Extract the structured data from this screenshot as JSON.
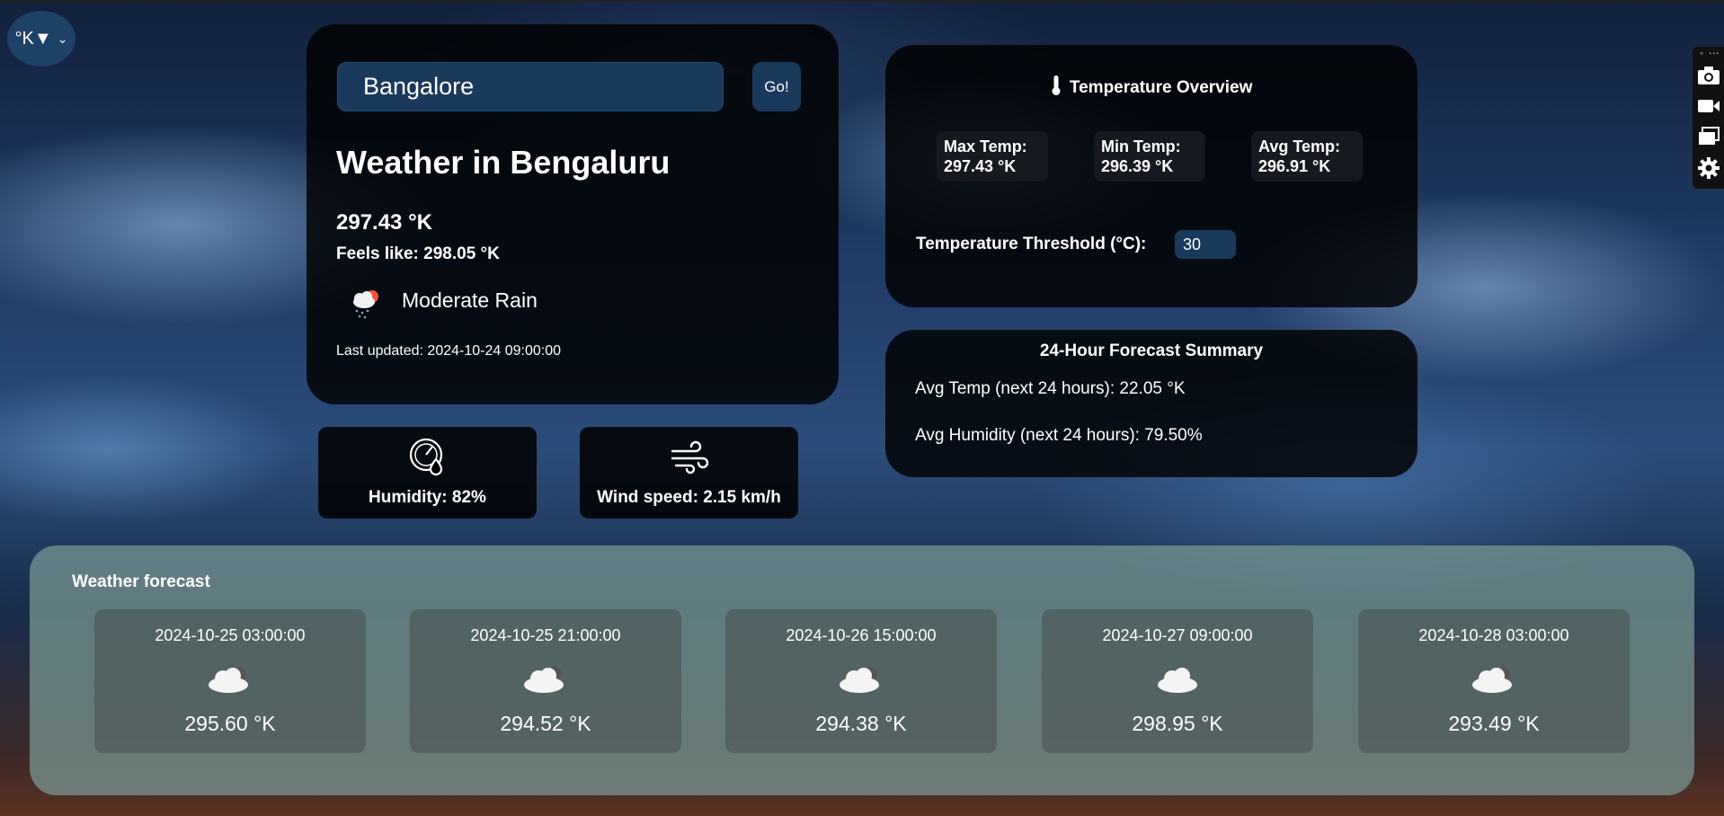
{
  "unit_selector": {
    "value": "°K▼",
    "chevron": "⌄"
  },
  "search": {
    "value": "Bangalore",
    "button_label": "Go!"
  },
  "current": {
    "title": "Weather in Bengaluru",
    "temperature": "297.43 °K",
    "feels_like": "Feels like: 298.05 °K",
    "condition": "Moderate Rain",
    "condition_icon": "cloud-sun-rain-icon",
    "last_updated": "Last updated: 2024-10-24 09:00:00"
  },
  "humidity": {
    "label": "Humidity: 82%",
    "icon": "humidity-gauge-icon"
  },
  "wind": {
    "label": "Wind speed: 2.15 km/h",
    "icon": "wind-icon"
  },
  "overview": {
    "title": "Temperature Overview",
    "icon": "thermometer-icon",
    "max_label": "Max Temp:",
    "max_value": "297.43 °K",
    "min_label": "Min Temp:",
    "min_value": "296.39 °K",
    "avg_label": "Avg Temp:",
    "avg_value": "296.91 °K",
    "threshold_label": "Temperature Threshold (°C):",
    "threshold_value": "30"
  },
  "summary": {
    "title": "24-Hour Forecast Summary",
    "avg_temp": "Avg Temp (next 24 hours): 22.05 °K",
    "avg_humidity": "Avg Humidity (next 24 hours): 79.50%"
  },
  "forecast": {
    "title": "Weather forecast",
    "items": [
      {
        "date": "2024-10-25 03:00:00",
        "temp": "295.60 °K",
        "icon": "cloud-icon"
      },
      {
        "date": "2024-10-25 21:00:00",
        "temp": "294.52 °K",
        "icon": "cloud-icon"
      },
      {
        "date": "2024-10-26 15:00:00",
        "temp": "294.38 °K",
        "icon": "cloud-icon"
      },
      {
        "date": "2024-10-27 09:00:00",
        "temp": "298.95 °K",
        "icon": "cloud-icon"
      },
      {
        "date": "2024-10-28 03:00:00",
        "temp": "293.49 °K",
        "icon": "cloud-icon"
      }
    ]
  },
  "toolbar": {
    "dots": "◦ ⋯",
    "items": [
      "camera-icon",
      "video-icon",
      "windows-icon",
      "gear-icon"
    ]
  }
}
